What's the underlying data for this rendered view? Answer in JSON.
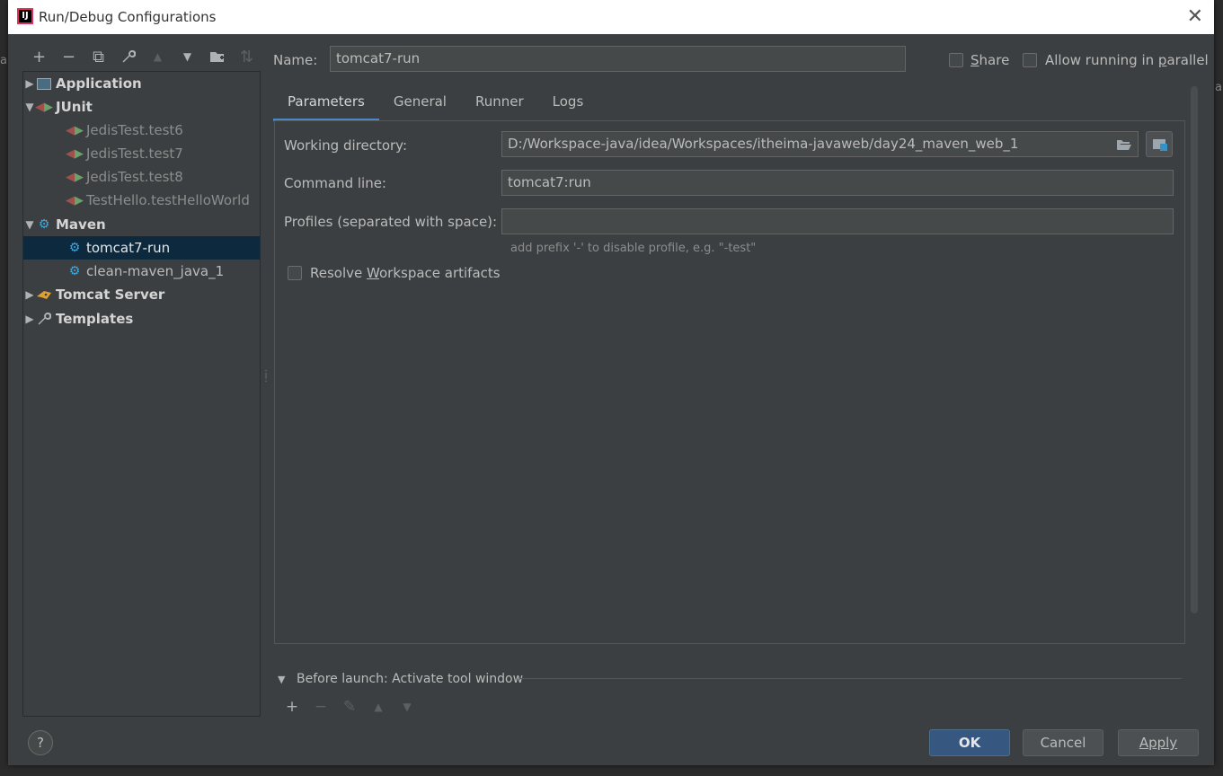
{
  "dialog": {
    "title": "Run/Debug Configurations",
    "app_icon_text": "IJ",
    "close_glyph": "✕"
  },
  "toolbar": {
    "items": [
      {
        "name": "add-icon",
        "glyph": "+"
      },
      {
        "name": "remove-icon",
        "glyph": "−"
      },
      {
        "name": "copy-icon",
        "glyph": "⧉"
      },
      {
        "name": "wrench-icon",
        "glyph": "🔧"
      },
      {
        "name": "move-up-icon",
        "glyph": "▲"
      },
      {
        "name": "move-down-icon",
        "glyph": "▼"
      },
      {
        "name": "new-folder-icon",
        "glyph": "📁"
      },
      {
        "name": "sort-icon",
        "glyph": "⇅"
      }
    ]
  },
  "tree": {
    "application": "Application",
    "junit": "JUnit",
    "junit_items": [
      "JedisTest.test6",
      "JedisTest.test7",
      "JedisTest.test8",
      "TestHello.testHelloWorld"
    ],
    "maven": "Maven",
    "maven_items": [
      "tomcat7-run",
      "clean-maven_java_1"
    ],
    "tomcat": "Tomcat Server",
    "templates": "Templates"
  },
  "name": {
    "label": "Name:",
    "value": "tomcat7-run"
  },
  "share": {
    "label_pre": "",
    "label_ul": "S",
    "label_post": "hare",
    "checked": false
  },
  "parallel": {
    "label_pre": "Allow running in ",
    "label_ul": "p",
    "label_post": "arallel",
    "checked": false
  },
  "tabs": [
    "Parameters",
    "General",
    "Runner",
    "Logs"
  ],
  "form": {
    "working_directory_label": "Working directory:",
    "working_directory_value": "D:/Workspace-java/idea/Workspaces/itheima-javaweb/day24_maven_web_1",
    "command_line_label": "Command line:",
    "command_line_value": "tomcat7:run",
    "profiles_label": "Profiles (separated with space):",
    "profiles_value": "",
    "profiles_hint": "add prefix '-' to disable profile, e.g. \"-test\"",
    "resolve_pre": "Resolve ",
    "resolve_ul": "W",
    "resolve_post": "orkspace artifacts",
    "resolve_checked": false
  },
  "before_launch": {
    "label": "Before launch: Activate tool window",
    "tools": [
      {
        "name": "add-icon",
        "glyph": "+",
        "enabled": true
      },
      {
        "name": "remove-icon",
        "glyph": "−",
        "enabled": false
      },
      {
        "name": "edit-icon",
        "glyph": "✎",
        "enabled": false
      },
      {
        "name": "move-up-icon",
        "glyph": "▲",
        "enabled": false
      },
      {
        "name": "move-down-icon",
        "glyph": "▼",
        "enabled": false
      }
    ]
  },
  "buttons": {
    "ok": "OK",
    "cancel": "Cancel",
    "apply": "Apply",
    "help": "?"
  },
  "colors": {
    "accent": "#4a88c7",
    "selection": "#0d293e",
    "primary_button": "#365880"
  }
}
